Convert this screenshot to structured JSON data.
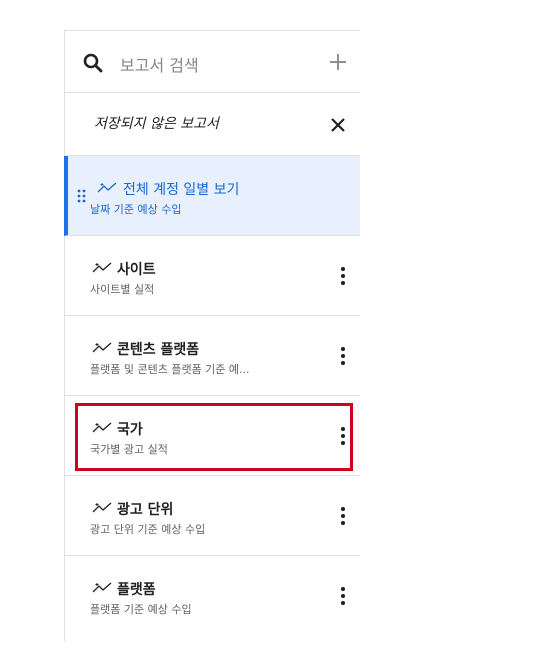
{
  "search": {
    "placeholder": "보고서 검색"
  },
  "unsaved_report": {
    "label": "저장되지 않은 보고서"
  },
  "reports": [
    {
      "title": "전체 계정 일별 보기",
      "subtitle": "날짜 기준 예상 수입",
      "selected": true
    },
    {
      "title": "사이트",
      "subtitle": "사이트별 실적",
      "selected": false
    },
    {
      "title": "콘텐츠 플랫폼",
      "subtitle": "플랫폼 및 콘텐츠 플랫폼 기준 예...",
      "selected": false
    },
    {
      "title": "국가",
      "subtitle": "국가별 광고 실적",
      "selected": false
    },
    {
      "title": "광고 단위",
      "subtitle": "광고 단위 기준 예상 수입",
      "selected": false
    },
    {
      "title": "플랫폼",
      "subtitle": "플랫폼 기준 예상 수입",
      "selected": false
    }
  ],
  "colors": {
    "accent": "#1a73e8",
    "selected_bg": "#e8f0fe",
    "highlight": "#d0021b"
  }
}
